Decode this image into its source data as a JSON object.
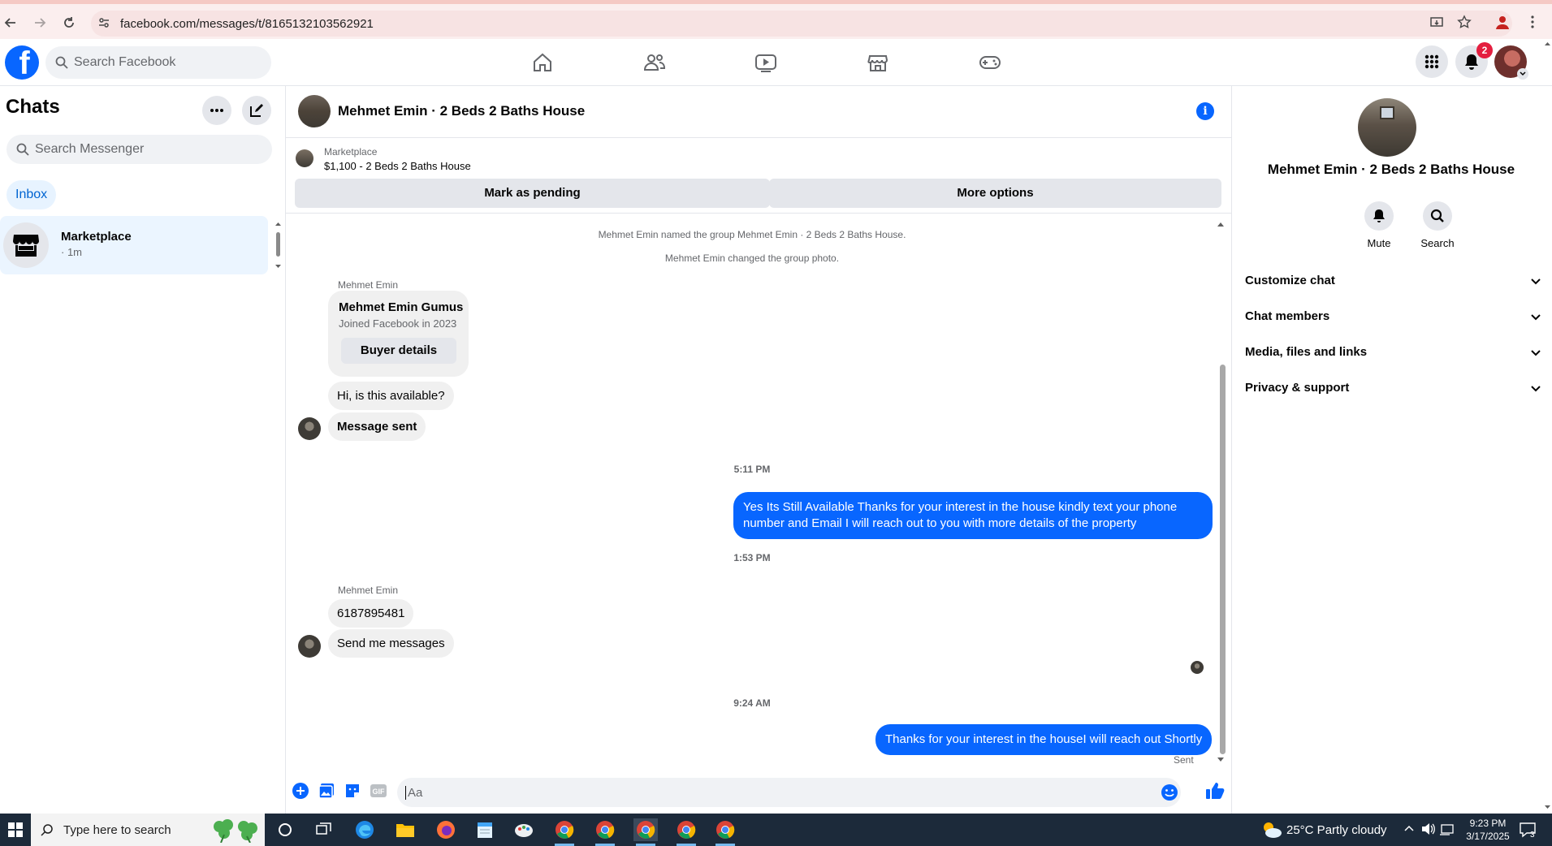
{
  "browser": {
    "url": "facebook.com/messages/t/8165132103562921"
  },
  "facebook": {
    "search_placeholder": "Search Facebook",
    "notification_count": "2"
  },
  "left": {
    "title": "Chats",
    "search_placeholder": "Search Messenger",
    "inbox_label": "Inbox",
    "conversations": [
      {
        "name": "Marketplace",
        "meta": "· 1m"
      }
    ]
  },
  "conversation": {
    "title": "Mehmet Emin · 2 Beds 2 Baths House",
    "marketplace_label": "Marketplace",
    "listing": "$1,100 - 2 Beds 2 Baths House",
    "mark_pending": "Mark as pending",
    "more_options": "More options",
    "system_messages": [
      "Mehmet Emin named the group Mehmet Emin · 2 Beds 2 Baths House.",
      "Mehmet Emin changed the group photo."
    ],
    "sender": "Mehmet Emin",
    "buyer_card": {
      "name": "Mehmet Emin Gumus",
      "joined": "Joined Facebook in 2023",
      "button": "Buyer details"
    },
    "messages": {
      "in1": "Hi, is this available?",
      "in2": "Message sent",
      "time1": "5:11 PM",
      "out1": "Yes Its Still Available Thanks for your interest in the house kindly text your phone number and Email I will reach out to you with more details of the property",
      "time2": "1:53 PM",
      "sender2": "Mehmet Emin",
      "in3": "6187895481",
      "in4": "Send me messages",
      "time3": "9:24 AM",
      "out2": "Thanks for your interest in the houseI will reach out Shortly",
      "status": "Sent"
    },
    "composer_placeholder": "Aa"
  },
  "right": {
    "title": "Mehmet Emin · 2 Beds 2 Baths House",
    "actions": [
      "Mute",
      "Search"
    ],
    "sections": [
      "Customize chat",
      "Chat members",
      "Media, files and links",
      "Privacy & support"
    ]
  },
  "taskbar": {
    "search_placeholder": "Type here to search",
    "weather": "25°C  Partly cloudy",
    "time": "9:23 PM",
    "date": "3/17/2025",
    "notif_count": "3"
  },
  "colors": {
    "fb_blue": "#0866ff",
    "bubble_in": "#f0f0f0",
    "secondary_text": "#65676b"
  }
}
